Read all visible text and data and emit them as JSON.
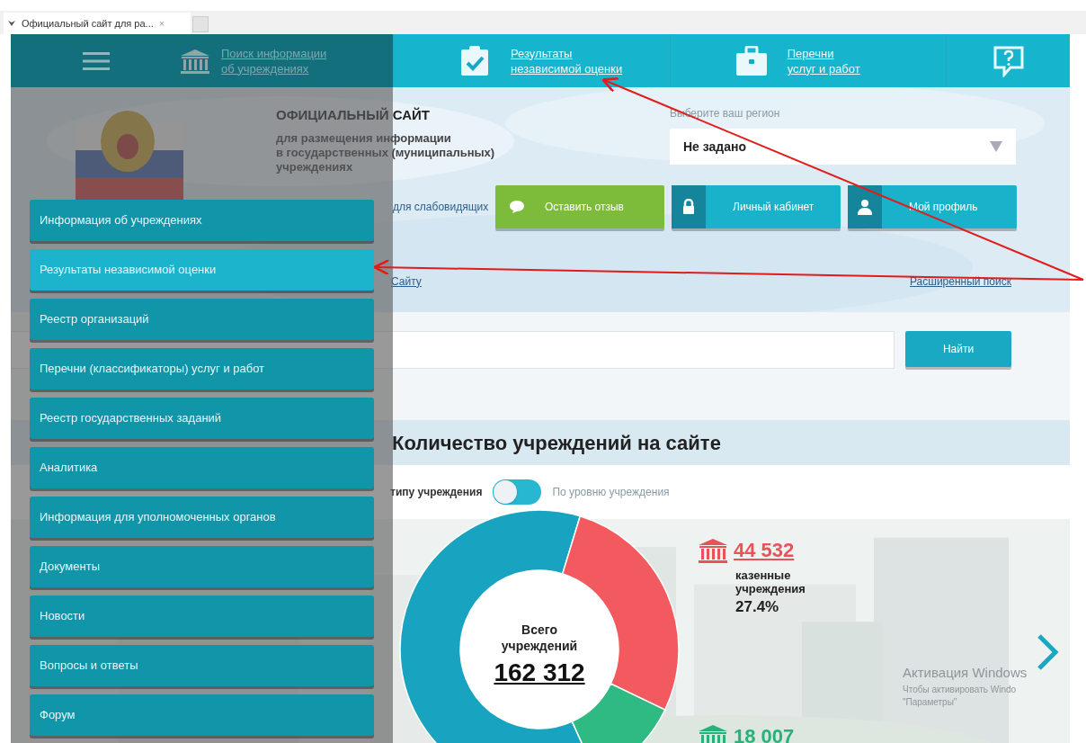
{
  "browser_tab": {
    "title": "Официальный сайт для ра...",
    "close": "×"
  },
  "drawer": {
    "header_lines": [
      "Поиск информации",
      "об учреждениях"
    ],
    "items": [
      {
        "label": "Информация об учреждениях",
        "selected": false
      },
      {
        "label": "Результаты независимой оценки",
        "selected": true
      },
      {
        "label": "Реестр организаций",
        "selected": false
      },
      {
        "label": "Перечни (классификаторы) услуг и работ",
        "selected": false
      },
      {
        "label": "Реестр государственных заданий",
        "selected": false
      },
      {
        "label": "Аналитика",
        "selected": false
      },
      {
        "label": "Информация для уполномоченных органов",
        "selected": false
      },
      {
        "label": "Документы",
        "selected": false
      },
      {
        "label": "Новости",
        "selected": false
      },
      {
        "label": "Вопросы и ответы",
        "selected": false
      },
      {
        "label": "Форум",
        "selected": false
      }
    ]
  },
  "nav": [
    {
      "kind": "clipboard",
      "lines": [
        "Результаты",
        "независимой оценки"
      ]
    },
    {
      "kind": "briefcase",
      "lines": [
        "Перечни",
        "услуг и работ"
      ]
    },
    {
      "kind": "help"
    }
  ],
  "site": {
    "title": "ОФИЦИАЛЬНЫЙ САЙТ",
    "subtitle_lines": [
      "для размещения информации",
      "в государственных (муниципальных)",
      "учреждениях"
    ],
    "accessibility_link": "для слабовидящих"
  },
  "region": {
    "label": "Выберите ваш регион",
    "value": "Не задано"
  },
  "buttons": [
    {
      "kind": "feedback",
      "label": "Оставить отзыв"
    },
    {
      "kind": "lock",
      "label": "Личный кабинет"
    },
    {
      "kind": "user",
      "label": "Мой профиль"
    }
  ],
  "search": {
    "link": "Сайту",
    "advanced": "Расширенный поиск",
    "button": "Найти"
  },
  "stats": {
    "heading": "Количество учреждений на сайте",
    "toggle": {
      "left": "типу учреждения",
      "right": "По уровню учреждения",
      "on": false
    },
    "total_lines": [
      "Всего",
      "учреждений"
    ],
    "total": "162 312",
    "legend": [
      {
        "value": "44 532",
        "lines": [
          "казенные",
          "учреждения"
        ],
        "percent": "27.4%",
        "color": "#e8525a"
      },
      {
        "value": "18 007",
        "color": "#27b27a"
      }
    ],
    "chart_data": {
      "type": "donut",
      "values": [
        61.5,
        27.4,
        11.1
      ]
    }
  },
  "windows_notice": [
    "Активация Windows",
    "Чтобы активировать Windo",
    "\"Параметры\""
  ]
}
